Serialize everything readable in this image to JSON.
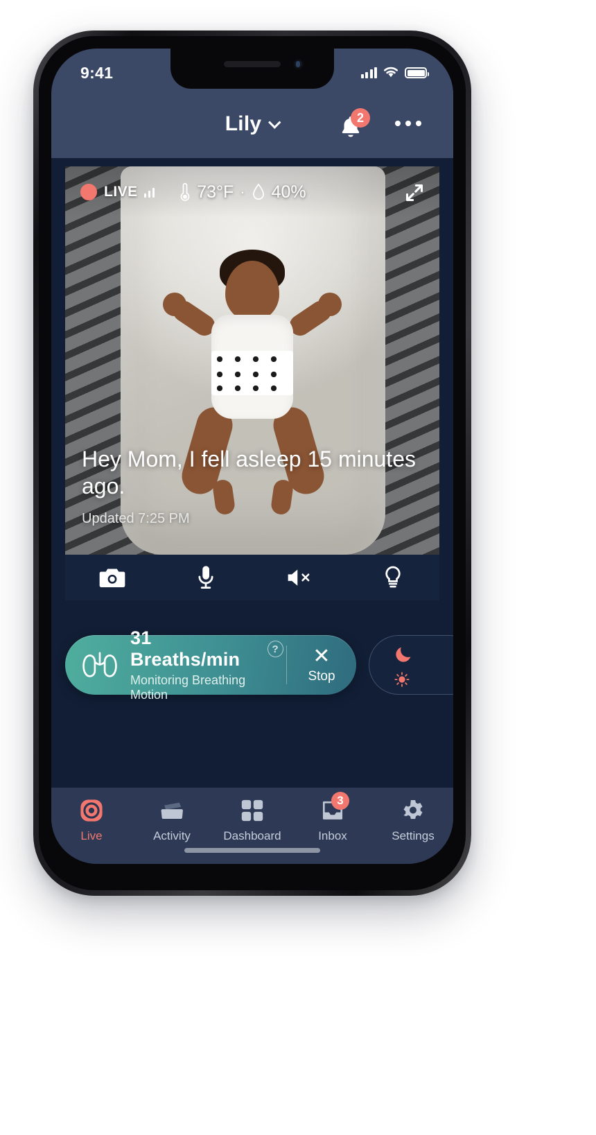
{
  "status_bar": {
    "time": "9:41",
    "cellular_icon": "signal-bars-icon",
    "wifi_icon": "wifi-icon",
    "battery_icon": "battery-full-icon"
  },
  "header": {
    "title": "Lily",
    "chevron_icon": "chevron-down-icon",
    "notifications": {
      "icon": "bell-icon",
      "badge": "2"
    },
    "more_icon": "more-horizontal-icon"
  },
  "video": {
    "live_label": "LIVE",
    "live_dot_color": "#f2776f",
    "signal_icon": "signal-bars-icon",
    "temperature_icon": "thermometer-icon",
    "temperature": "73°F",
    "separator": "·",
    "humidity_icon": "water-drop-icon",
    "humidity": "40%",
    "expand_icon": "expand-fullscreen-icon",
    "caption": "Hey Mom, I fell asleep 15 minutes ago.",
    "updated": "Updated 7:25 PM"
  },
  "video_controls": [
    {
      "name": "camera-snapshot-button",
      "icon": "camera-icon"
    },
    {
      "name": "talk-microphone-button",
      "icon": "microphone-icon"
    },
    {
      "name": "mute-speaker-button",
      "icon": "speaker-muted-icon"
    },
    {
      "name": "night-light-button",
      "icon": "lightbulb-icon"
    }
  ],
  "breathing": {
    "icon": "lungs-icon",
    "value": "31 Breaths/min",
    "help_label": "?",
    "subtitle": "Monitoring Breathing Motion",
    "stop_icon": "close-x-icon",
    "stop_label": "Stop",
    "gradient_from": "#4fae9e",
    "gradient_to": "#2f6b7e"
  },
  "night_card": {
    "moon_icon": "moon-icon",
    "sun_icon": "sun-icon",
    "accent_color": "#f2776f"
  },
  "tabs": [
    {
      "label": "Live",
      "icon": "live-target-icon",
      "active": true,
      "badge": ""
    },
    {
      "label": "Activity",
      "icon": "activity-card-icon",
      "active": false,
      "badge": ""
    },
    {
      "label": "Dashboard",
      "icon": "grid-squares-icon",
      "active": false,
      "badge": ""
    },
    {
      "label": "Inbox",
      "icon": "inbox-tray-icon",
      "active": false,
      "badge": "3"
    },
    {
      "label": "Settings",
      "icon": "gear-icon",
      "active": false,
      "badge": ""
    }
  ],
  "theme": {
    "header_bg": "#3b4866",
    "app_bg": "#111e35",
    "tab_bar_bg": "#2e3a55",
    "accent": "#f2776f"
  }
}
